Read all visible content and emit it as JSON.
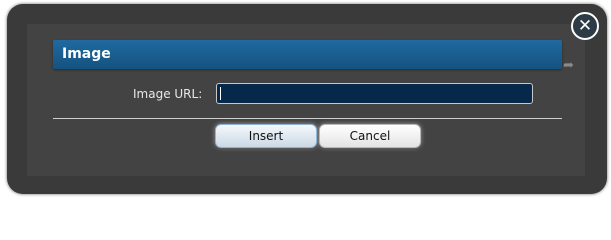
{
  "dialog": {
    "title": "Image",
    "url_label": "Image URL:",
    "url_value": ""
  },
  "buttons": {
    "insert": "Insert",
    "cancel": "Cancel"
  },
  "close_icon": "close-icon",
  "colors": {
    "header": "#1a5e91",
    "input_bg": "#06284a",
    "modal_bg": "#3a3a3a"
  }
}
